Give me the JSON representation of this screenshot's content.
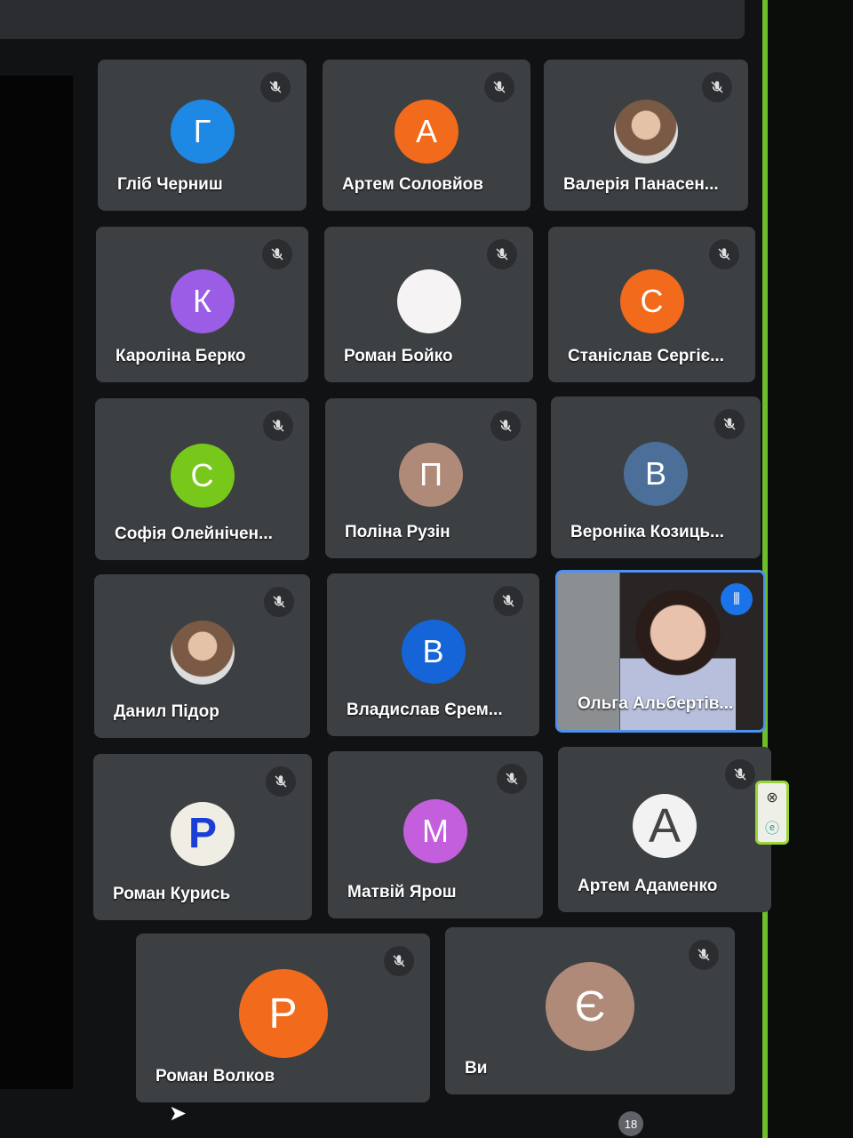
{
  "participants_count": "18",
  "tiles": [
    {
      "name": "Гліб Черниш",
      "initial": "Г",
      "color": "#1e88e5",
      "muted": true
    },
    {
      "name": "Артем Соловйов",
      "initial": "А",
      "color": "#f26a1b",
      "muted": true
    },
    {
      "name": "Валерія Панасен...",
      "initial": "",
      "color": "photo",
      "muted": true
    },
    {
      "name": "Кароліна Берко",
      "initial": "К",
      "color": "#9b5de5",
      "muted": true
    },
    {
      "name": "Роман Бойко",
      "initial": "",
      "color": "#f5f3f4",
      "muted": true
    },
    {
      "name": "Станіслав Сергіє...",
      "initial": "С",
      "color": "#f26a1b",
      "muted": true
    },
    {
      "name": "Софія Олейнічен...",
      "initial": "С",
      "color": "#78c81c",
      "muted": true
    },
    {
      "name": "Поліна Рузін",
      "initial": "П",
      "color": "#b08a78",
      "muted": true
    },
    {
      "name": "Вероніка Козиць...",
      "initial": "В",
      "color": "#4b6f98",
      "muted": true
    },
    {
      "name": "Данил Підор",
      "initial": "",
      "color": "photo",
      "muted": true
    },
    {
      "name": "Владислав Єрем...",
      "initial": "В",
      "color": "#1565d8",
      "muted": true
    },
    {
      "name": "Ольга Альбертів...",
      "initial": "",
      "color": "video",
      "muted": false,
      "speaking": true
    },
    {
      "name": "Роман Курись",
      "initial": "P",
      "color": "#f0ede4",
      "muted": true
    },
    {
      "name": "Матвій Ярош",
      "initial": "М",
      "color": "#c35fdc",
      "muted": true
    },
    {
      "name": "Артем Адаменко",
      "initial": "A",
      "color": "#f2f2f2",
      "muted": true
    },
    {
      "name": "Роман Волков",
      "initial": "Р",
      "color": "#f26a1b",
      "muted": true
    },
    {
      "name": "Ви",
      "initial": "Є",
      "color": "#b08a78",
      "muted": true
    }
  ]
}
